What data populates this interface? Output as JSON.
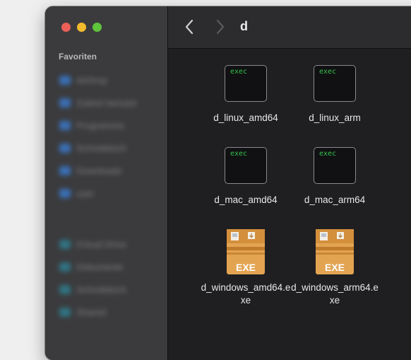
{
  "window": {
    "folder_title": "d"
  },
  "sidebar": {
    "favorites_label": "Favoriten",
    "favorites_items": [
      "AirDrop",
      "Zuletzt benutzt",
      "Programme",
      "Schreibtisch",
      "Downloads",
      "user"
    ],
    "locations_items": [
      "iCloud Drive",
      "Dokumente",
      "Schreibtisch",
      "Shared"
    ]
  },
  "toolbar": {
    "back_icon": "chevron-left-icon",
    "forward_icon": "chevron-right-icon"
  },
  "files": [
    {
      "name": "d_linux_amd64",
      "kind": "exec",
      "icon_text": "exec"
    },
    {
      "name": "d_linux_arm",
      "kind": "exec",
      "icon_text": "exec"
    },
    {
      "name": "d_mac_amd64",
      "kind": "exec",
      "icon_text": "exec"
    },
    {
      "name": "d_mac_arm64",
      "kind": "exec",
      "icon_text": "exec"
    },
    {
      "name": "d_windows_amd64.exe",
      "kind": "exe",
      "icon_text": "EXE"
    },
    {
      "name": "d_windows_arm64.exe",
      "kind": "exe",
      "icon_text": "EXE"
    }
  ],
  "colors": {
    "exec_text": "#35c24b",
    "box": "#e3a452",
    "accent_red": "#ec5f58",
    "accent_yellow": "#f2bb2e",
    "accent_green": "#5fc33c"
  }
}
